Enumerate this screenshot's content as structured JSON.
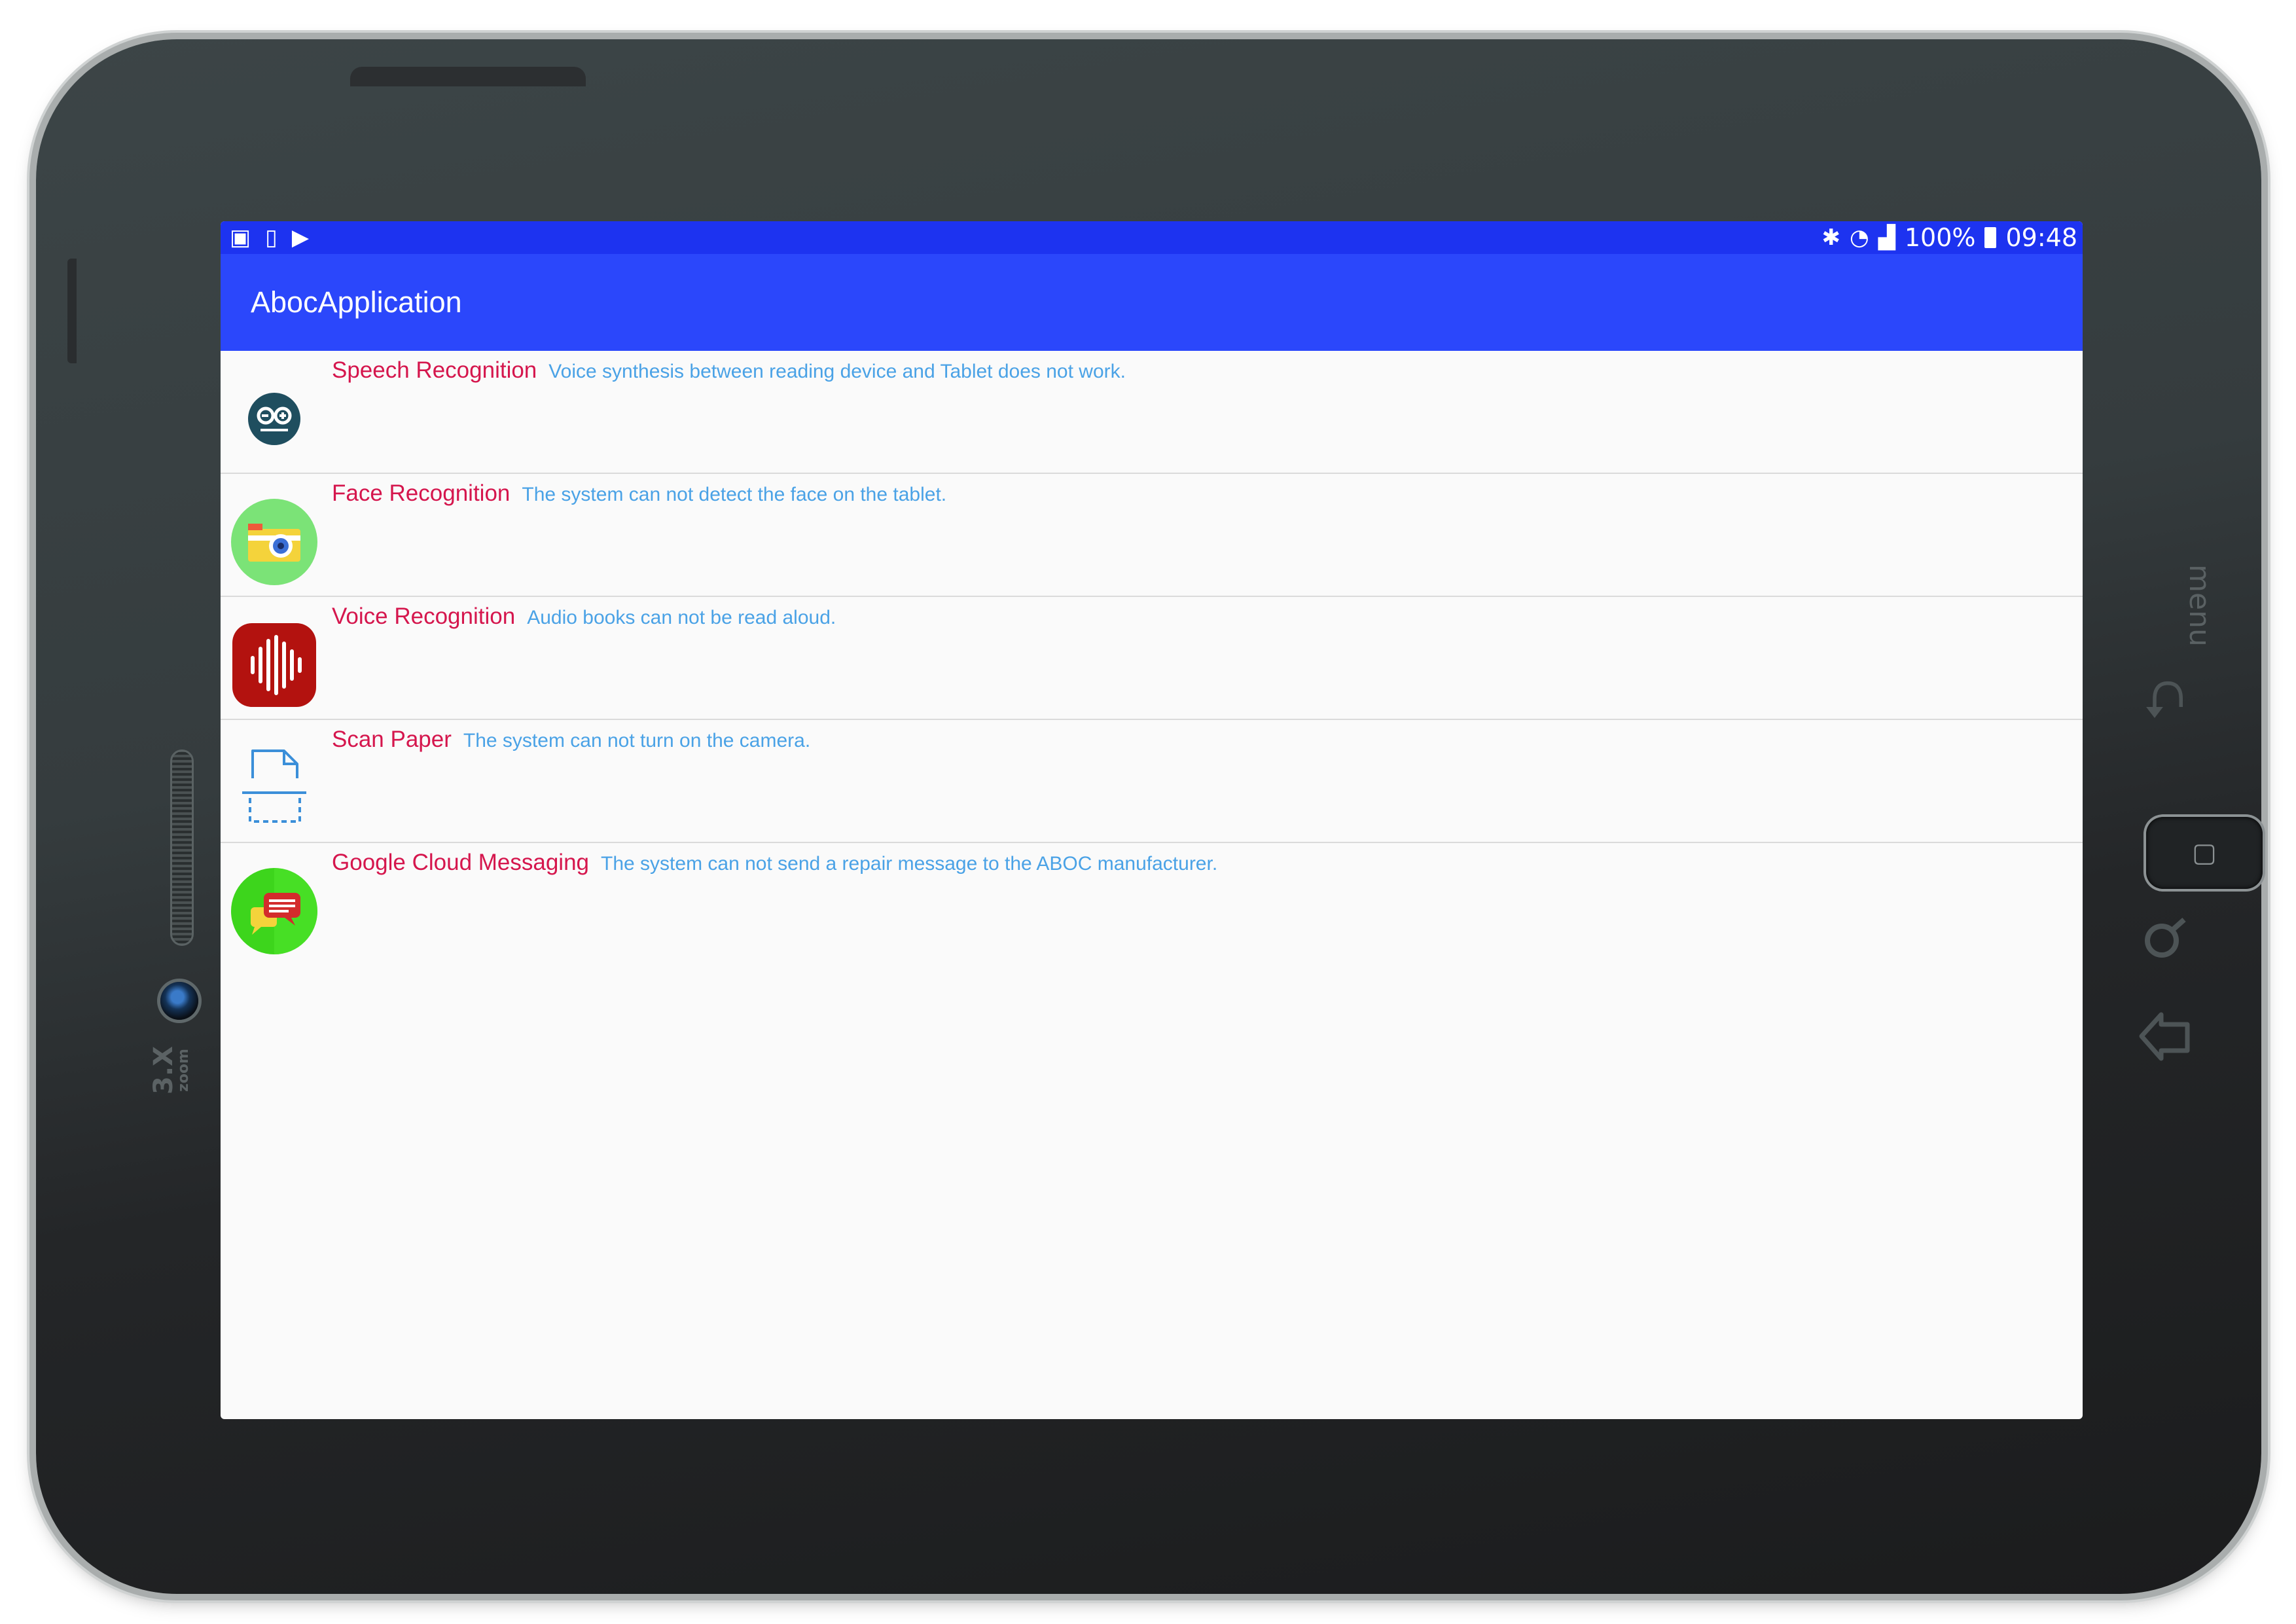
{
  "status_bar": {
    "battery_percent": "100%",
    "time": "09:48",
    "left_icons": [
      "gallery-icon",
      "device-sync-icon",
      "play-store-icon"
    ],
    "right_icons": [
      "bluetooth-icon",
      "wifi-icon",
      "signal-icon",
      "battery-icon"
    ]
  },
  "app_bar": {
    "title": "AbocApplication"
  },
  "list": {
    "items": [
      {
        "title": "Speech Recognition",
        "description": "Voice synthesis between reading device and Tablet does not work.",
        "icon": "arduino-icon",
        "icon_color": "#1f4e5f"
      },
      {
        "title": "Face Recognition",
        "description": "The system can not detect the face on the tablet.",
        "icon": "camera-icon",
        "icon_color": "#7be377"
      },
      {
        "title": "Voice Recognition",
        "description": "Audio books can not be read aloud.",
        "icon": "sound-wave-icon",
        "icon_color": "#b3120f"
      },
      {
        "title": "Scan Paper",
        "description": "The system can not turn on the camera.",
        "icon": "scan-document-icon",
        "icon_color": "#3b8fd9"
      },
      {
        "title": "Google Cloud Messaging",
        "description": "The system can not send a repair message to the ABOC manufacturer.",
        "icon": "chat-bubbles-icon",
        "icon_color": "#3dd51c"
      }
    ]
  },
  "device": {
    "menu_label": "menu",
    "zoom_label_big": "3.X",
    "zoom_label_small": "zoom"
  },
  "colors": {
    "status_bar": "#1d33f0",
    "app_bar": "#2b47fb",
    "item_title": "#d5164d",
    "item_description": "#4aa2e6"
  }
}
